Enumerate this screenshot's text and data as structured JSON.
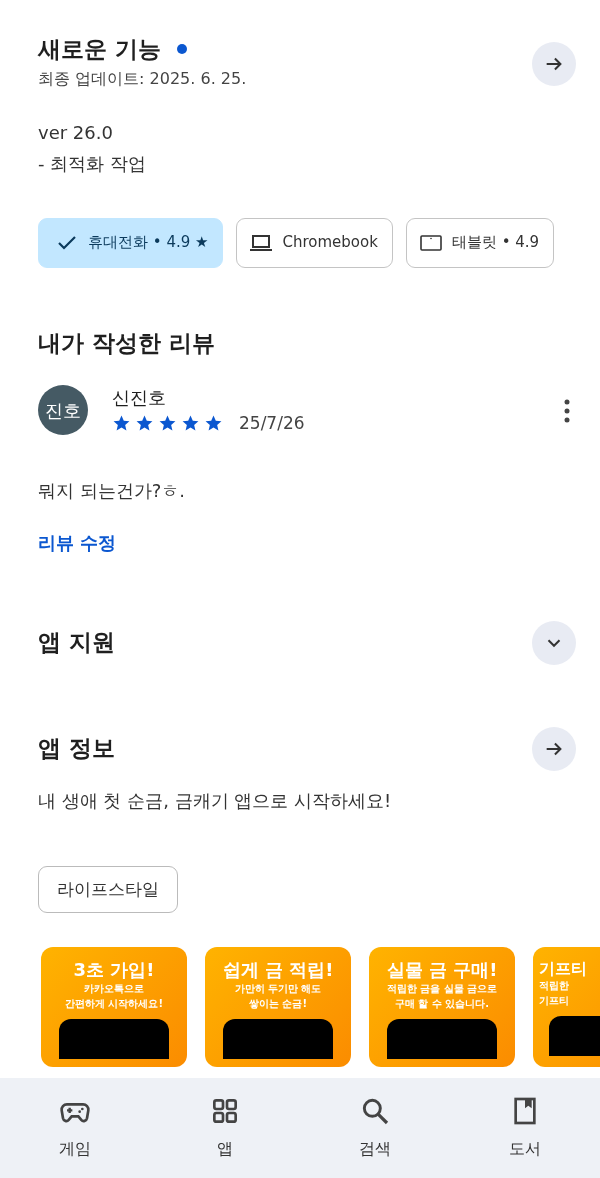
{
  "whats_new": {
    "title": "새로운 기능",
    "new_dot": true,
    "updated": "최종 업데이트: 2025. 6. 25.",
    "notes": [
      "ver 26.0",
      "- 최적화 작업"
    ]
  },
  "device_chips": [
    {
      "kind": "phone",
      "label": "휴대전화 • 4.9 ★",
      "selected": true
    },
    {
      "kind": "laptop",
      "label": "Chromebook",
      "selected": false
    },
    {
      "kind": "tablet",
      "label": "태블릿 • 4.9",
      "selected": false
    }
  ],
  "my_review": {
    "heading": "내가 작성한 리뷰",
    "avatar": "진호",
    "author": "신진호",
    "stars": 5,
    "date": "25/7/26",
    "text": "뭐지 되는건가?ㅎ.",
    "edit_link": "리뷰 수정"
  },
  "app_support": {
    "heading": "앱 지원",
    "expanded": false
  },
  "app_info": {
    "heading": "앱 정보",
    "description": "내 생애 첫 순금, 금캐기 앱으로 시작하세요!",
    "category": "라이프스타일"
  },
  "screenshots": [
    {
      "title": "3초 가입!",
      "lines": [
        "카카오톡으로",
        "간편하게 시작하세요!"
      ]
    },
    {
      "title": "쉽게 금 적립!",
      "lines": [
        "가만히 두기만 해도",
        "쌓이는 순금!"
      ]
    },
    {
      "title": "실물 금 구매!",
      "lines": [
        "적립한 금을 실물 금으로",
        "구매 할 수 있습니다."
      ]
    },
    {
      "title": "기프티",
      "lines": [
        "적립한",
        "기프티"
      ]
    }
  ],
  "bottom_nav": [
    {
      "kind": "games",
      "label": "게임"
    },
    {
      "kind": "apps",
      "label": "앱"
    },
    {
      "kind": "search",
      "label": "검색"
    },
    {
      "kind": "books",
      "label": "도서"
    }
  ]
}
